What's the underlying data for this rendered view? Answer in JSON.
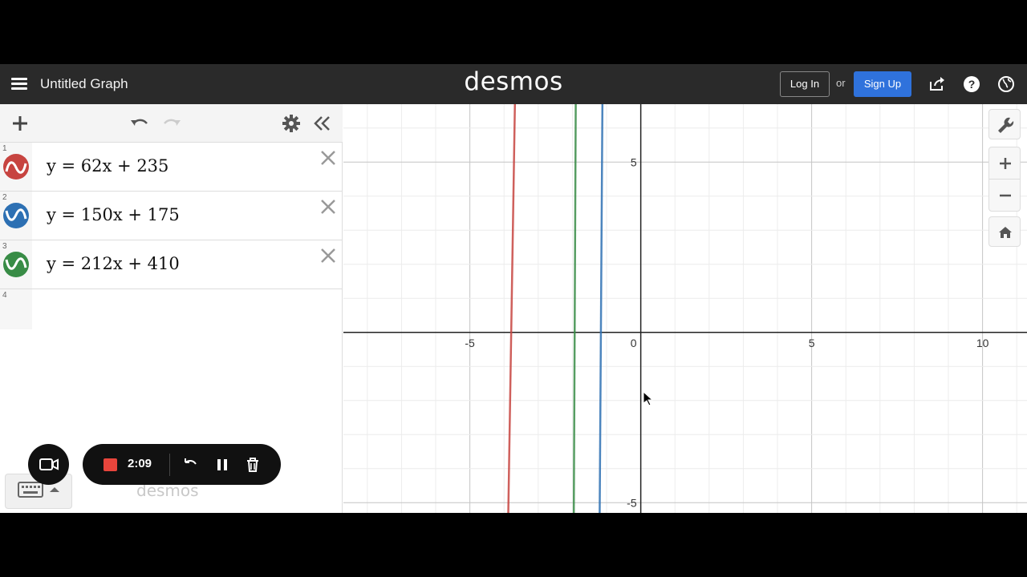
{
  "header": {
    "title": "Untitled Graph",
    "logo": "desmos",
    "login_label": "Log In",
    "or_label": "or",
    "signup_label": "Sign Up",
    "accent_color": "#2f72dc"
  },
  "expressions": [
    {
      "index": "1",
      "latex_display": "y = 62x + 235",
      "color": "#c74440"
    },
    {
      "index": "2",
      "latex_display": "y = 150x + 175",
      "color": "#2d70b3"
    },
    {
      "index": "3",
      "latex_display": "y = 212x + 410",
      "color": "#388c46"
    }
  ],
  "empty_row": {
    "index": "4"
  },
  "watermark": "desmos",
  "recorder": {
    "time": "2:09",
    "stop_color": "#e8453c"
  },
  "graph": {
    "x_ticks": [
      "-5",
      "0",
      "5",
      "10"
    ],
    "y_ticks": [
      "5",
      "-5"
    ],
    "x_range": [
      -8.7,
      11.3
    ],
    "y_range": [
      -5.3,
      6.7
    ],
    "lines": [
      {
        "slope": 62,
        "intercept": 235,
        "color": "#c74440"
      },
      {
        "slope": 150,
        "intercept": 175,
        "color": "#2d70b3"
      },
      {
        "slope": 212,
        "intercept": 410,
        "color": "#388c46"
      }
    ]
  },
  "icons": {
    "menu": "hamburger-icon",
    "share": "share-icon",
    "help": "help-icon",
    "language": "globe-icon",
    "add": "plus-icon",
    "undo": "undo-icon",
    "redo": "redo-icon",
    "settings": "gear-icon",
    "collapse": "double-chevron-left-icon",
    "wrench": "wrench-icon",
    "zoom_in": "plus-icon",
    "zoom_out": "minus-icon",
    "home": "home-icon"
  }
}
